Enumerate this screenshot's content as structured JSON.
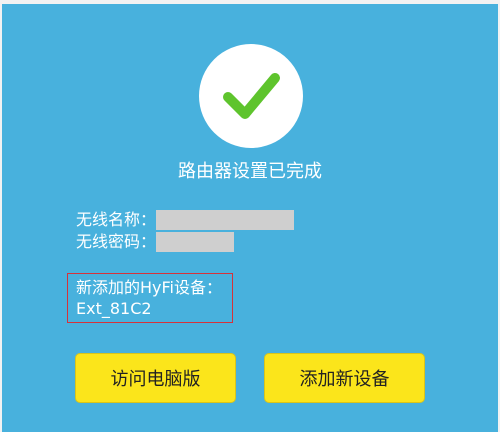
{
  "status": {
    "icon": "checkmark-icon",
    "title": "路由器设置已完成"
  },
  "wireless": {
    "name_label": "无线名称：",
    "password_label": "无线密码："
  },
  "hyfi": {
    "label": "新添加的HyFi设备：",
    "device_name": "Ext_81C2"
  },
  "buttons": {
    "visit_web": "访问电脑版",
    "add_device": "添加新设备"
  },
  "colors": {
    "background": "#48b1dd",
    "check": "#5ec42d",
    "button": "#fbe51b",
    "highlight_border": "#d6323a"
  }
}
